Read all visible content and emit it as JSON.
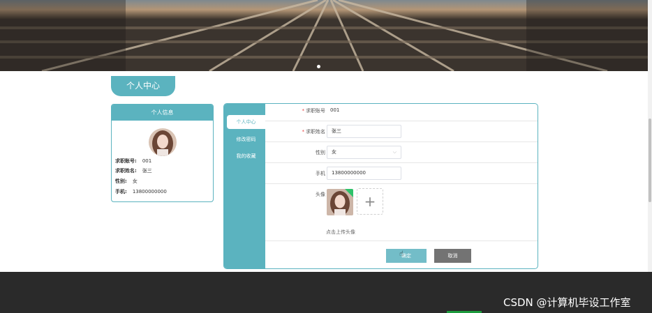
{
  "page": {
    "title": "个人中心"
  },
  "profile_card": {
    "header": "个人信息",
    "fields": [
      {
        "label": "求职账号:",
        "value": "001"
      },
      {
        "label": "求职姓名:",
        "value": "张三"
      },
      {
        "label": "性别:",
        "value": "女"
      },
      {
        "label": "手机:",
        "value": "13800000000"
      }
    ]
  },
  "sidebar": {
    "items": [
      {
        "label": "个人中心",
        "active": true
      },
      {
        "label": "修改密码",
        "active": false
      },
      {
        "label": "我的收藏",
        "active": false
      }
    ]
  },
  "form": {
    "account": {
      "label": "求职账号",
      "required": true,
      "value": "001"
    },
    "name": {
      "label": "求职姓名",
      "required": true,
      "value": "张三"
    },
    "gender": {
      "label": "性别",
      "value": "女"
    },
    "phone": {
      "label": "手机",
      "value": "13800000000"
    },
    "avatar": {
      "label": "头像",
      "plus": "+",
      "hint": "点击上传头像"
    },
    "submit_label": "确定",
    "cancel_label": "取消",
    "asterisk": "*"
  },
  "watermark": "CSDN @计算机毕设工作室",
  "icons": {
    "chevron": "chevron-down-icon",
    "upload": "plus-icon",
    "cursor": "hand-cursor-icon"
  },
  "colors": {
    "accent": "#5bb3bf",
    "required": "#e64545",
    "cancel": "#737373",
    "footer": "#2a2a2a"
  }
}
